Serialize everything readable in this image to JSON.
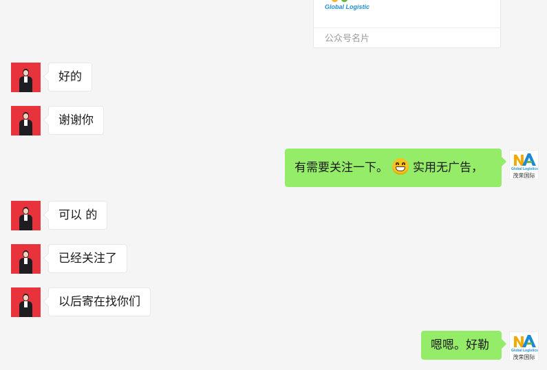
{
  "card": {
    "logo_text": "Global Logistic",
    "label": "公众号名片"
  },
  "messages": [
    {
      "side": "left",
      "text": "好的"
    },
    {
      "side": "left",
      "text": "谢谢你"
    },
    {
      "side": "right",
      "text_before": "有需要关注一下。",
      "emoji": "grinning-emoji",
      "text_after": "实用无广告，"
    },
    {
      "side": "left",
      "text": "可以 的"
    },
    {
      "side": "left",
      "text": "已经关注了"
    },
    {
      "side": "left",
      "text": "以后寄在找你们"
    },
    {
      "side": "right",
      "text": "嗯嗯。好勒"
    }
  ],
  "brand_avatar": {
    "brand_text": "Global Logistics",
    "cn_text": "茂荣国际",
    "colors": {
      "m": "#f2a900",
      "a": "#1b8ad3",
      "accent": "#6fb93a"
    }
  },
  "colors": {
    "background": "#f5f5f5",
    "bubble_self": "#95ec69",
    "bubble_other": "#ffffff",
    "avatar_red": "#e8323c"
  }
}
